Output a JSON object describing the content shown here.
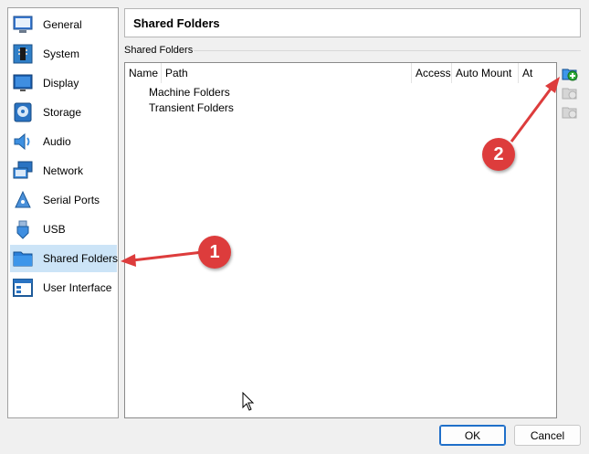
{
  "sidebar": {
    "items": [
      {
        "label": "General",
        "icon": "general-icon"
      },
      {
        "label": "System",
        "icon": "system-icon"
      },
      {
        "label": "Display",
        "icon": "display-icon"
      },
      {
        "label": "Storage",
        "icon": "storage-icon"
      },
      {
        "label": "Audio",
        "icon": "audio-icon"
      },
      {
        "label": "Network",
        "icon": "network-icon"
      },
      {
        "label": "Serial Ports",
        "icon": "serial-ports-icon"
      },
      {
        "label": "USB",
        "icon": "usb-icon"
      },
      {
        "label": "Shared Folders",
        "icon": "shared-folders-icon",
        "selected": true
      },
      {
        "label": "User Interface",
        "icon": "user-interface-icon"
      }
    ]
  },
  "page": {
    "title": "Shared Folders",
    "group_label": "Shared Folders"
  },
  "table": {
    "columns": [
      "Name",
      "Path",
      "Access",
      "Auto Mount",
      "At"
    ],
    "rows": [
      "Machine Folders",
      "Transient Folders"
    ]
  },
  "toolbar": {
    "add_icon": "add-folder-icon",
    "edit_icon": "edit-folder-icon",
    "remove_icon": "remove-folder-icon"
  },
  "buttons": {
    "ok": "OK",
    "cancel": "Cancel"
  },
  "annotations": {
    "badge1": "1",
    "badge2": "2",
    "color": "#dd3c3c"
  }
}
